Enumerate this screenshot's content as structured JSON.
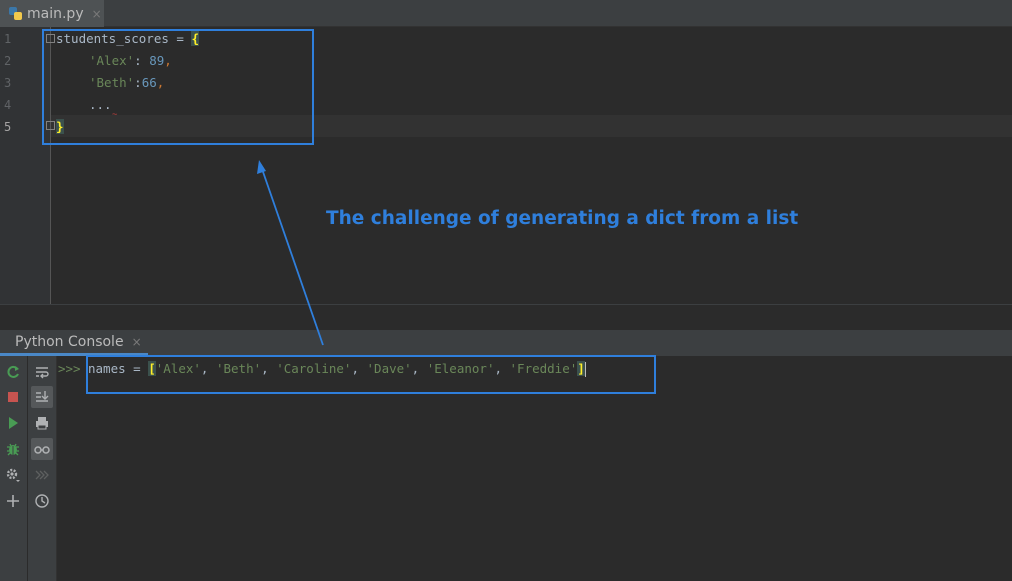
{
  "editor": {
    "tab": {
      "label": "main.py",
      "close": "×",
      "icon": "python-file-icon"
    },
    "line_numbers": [
      "1",
      "2",
      "3",
      "4",
      "5"
    ],
    "current_line": "5",
    "code": {
      "l1_var": "students_scores",
      "l1_op": " = ",
      "l1_brace": "{",
      "l2_key": "'Alex'",
      "l2_colon": ": ",
      "l2_val": "89",
      "l2_comma": ",",
      "l3_key": "'Beth'",
      "l3_colon": ":",
      "l3_val": "66",
      "l3_comma": ",",
      "l4_text": "...",
      "l5_brace": "}"
    }
  },
  "annotation": {
    "text": "The challenge of generating a dict from a list",
    "color": "#2f7fdc"
  },
  "console": {
    "tab_label": "Python Console",
    "tab_close": "×",
    "prompt": ">>>",
    "input": {
      "var": "names",
      "op": " = ",
      "open": "[",
      "items": [
        "'Alex'",
        "'Beth'",
        "'Caroline'",
        "'Dave'",
        "'Eleanor'",
        "'Freddie'"
      ],
      "sep1": ", ",
      "sep2": ", ",
      "sep3": ", ",
      "sep4": ", ",
      "sep5": ", ",
      "close": "]"
    },
    "toolbar_left": [
      "rerun-icon",
      "stop-icon",
      "run-icon",
      "debug-icon",
      "settings-icon",
      "add-icon"
    ],
    "toolbar_right": [
      "soft-wrap-icon",
      "scroll-to-end-icon",
      "print-icon",
      "show-variables-icon",
      "execute-history-icon",
      "history-icon"
    ]
  },
  "colors": {
    "background": "#2b2b2b",
    "string": "#6a8759",
    "number": "#6897bb",
    "keyword_op": "#cc7832",
    "highlight_box": "#2f7fdc"
  }
}
